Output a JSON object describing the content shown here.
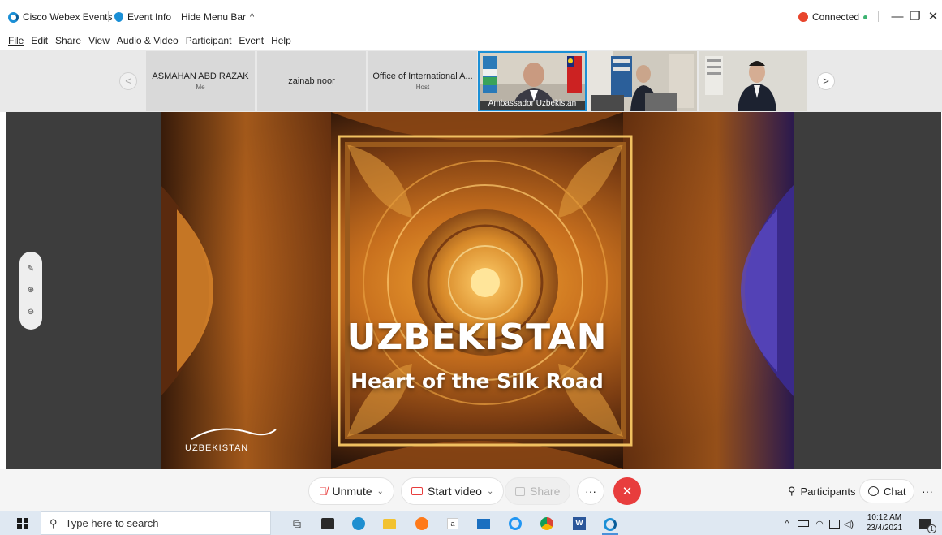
{
  "titlebar": {
    "app_title": "Cisco Webex Events",
    "event_info": "Event Info",
    "hide_menu": "Hide Menu Bar",
    "hide_menu_chevron": "^",
    "connected": "Connected",
    "minimize": "—",
    "restore": "❐",
    "close": "✕"
  },
  "menubar": {
    "items": [
      "File",
      "Edit",
      "Share",
      "View",
      "Audio & Video",
      "Participant",
      "Event",
      "Help"
    ]
  },
  "participants": {
    "prev": "<",
    "next": ">",
    "tiles": [
      {
        "name": "ASMAHAN ABD RAZAK",
        "sub": "Me"
      },
      {
        "name": "zainab noor",
        "sub": ""
      },
      {
        "name": "Office of International A...",
        "sub": "Host"
      }
    ],
    "video_tiles": [
      {
        "name": "Ambassador Uzbekistan"
      }
    ]
  },
  "slide": {
    "title": "UZBEKISTAN",
    "subtitle": "Heart of the Silk Road",
    "logo": "UZBEKISTAN"
  },
  "controls": {
    "unmute": "Unmute",
    "start_video": "Start video",
    "share": "Share",
    "more": "···",
    "end": "✕",
    "participants": "Participants",
    "chat": "Chat",
    "overflow": "···"
  },
  "taskbar": {
    "search_placeholder": "Type here to search",
    "time": "10:12 AM",
    "date": "23/4/2021",
    "notification_count": "1"
  },
  "colors": {
    "accent_blue": "#1a8fd6",
    "end_red": "#e83d3d",
    "connected_red": "#e8452c",
    "connected_green": "#3cb371"
  }
}
